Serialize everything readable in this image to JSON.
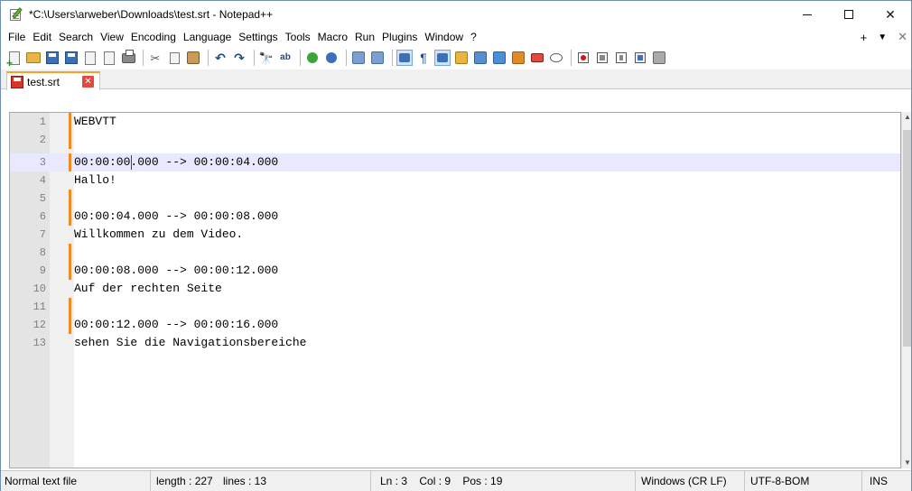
{
  "window": {
    "title": "*C:\\Users\\arweber\\Downloads\\test.srt - Notepad++",
    "controls": {
      "minimize": "",
      "maximize": "",
      "close": "✕"
    }
  },
  "menu": {
    "items": [
      "File",
      "Edit",
      "Search",
      "View",
      "Encoding",
      "Language",
      "Settings",
      "Tools",
      "Macro",
      "Run",
      "Plugins",
      "Window",
      "?"
    ],
    "right": {
      "plus": "+",
      "dropdown": "▼",
      "close": "✕"
    }
  },
  "toolbar": {
    "icons": [
      "new-file-icon",
      "open-folder-icon",
      "save-icon",
      "save-all-icon",
      "close-icon",
      "close-all-icon",
      "print-icon",
      "cut-icon",
      "copy-icon",
      "paste-icon",
      "undo-icon",
      "redo-icon",
      "find-icon",
      "replace-icon",
      "zoom-in-icon",
      "zoom-out-icon",
      "sync-vertical-icon",
      "sync-horizontal-icon",
      "word-wrap-icon",
      "show-all-chars-icon",
      "indent-guide-icon",
      "udl-icon",
      "doc-map-icon",
      "function-list-icon",
      "folder-workspace-icon",
      "monitoring-icon",
      "eye-icon",
      "record-macro-icon",
      "stop-record-icon",
      "play-macro-icon",
      "run-macro-multiple-icon",
      "save-macro-icon"
    ],
    "pilcrow": "¶"
  },
  "tabs": [
    {
      "label": "test.srt",
      "close": "✕"
    }
  ],
  "editor": {
    "current_line": 3,
    "lines": [
      {
        "num": "1",
        "text": "WEBVTT"
      },
      {
        "num": "2",
        "text": ""
      },
      {
        "num": "3",
        "text": "00:00:00.000 --> 00:00:04.000"
      },
      {
        "num": "4",
        "text": "Hallo!"
      },
      {
        "num": "5",
        "text": ""
      },
      {
        "num": "6",
        "text": "00:00:04.000 --> 00:00:08.000"
      },
      {
        "num": "7",
        "text": "Willkommen zu dem Video."
      },
      {
        "num": "8",
        "text": ""
      },
      {
        "num": "9",
        "text": "00:00:08.000 --> 00:00:12.000"
      },
      {
        "num": "10",
        "text": "Auf der rechten Seite"
      },
      {
        "num": "11",
        "text": ""
      },
      {
        "num": "12",
        "text": "00:00:12.000 --> 00:00:16.000"
      },
      {
        "num": "13",
        "text": "sehen Sie die Navigationsbereiche"
      }
    ]
  },
  "status": {
    "file_type": "Normal text file",
    "length": "length : 227",
    "lines": "lines : 13",
    "position": "Ln : 3    Col : 9    Pos : 19",
    "eol": "Windows (CR LF)",
    "encoding": "UTF-8-BOM",
    "mode": "INS"
  },
  "colors": {
    "change_marker": "#f08a24",
    "current_line_bg": "#e8e8ff",
    "caret": "#8000ff",
    "tab_accent": "#f3a12b"
  }
}
